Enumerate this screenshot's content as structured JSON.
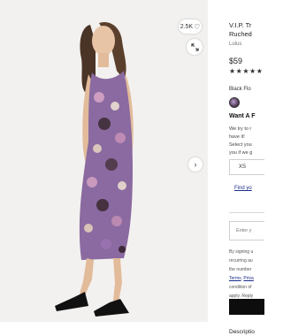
{
  "gallery": {
    "favorites_count": "2.5K",
    "heart_glyph": "♡",
    "next_glyph": "›",
    "icons": {
      "favorite": "heart-icon",
      "zoom": "expand-icon",
      "next": "chevron-right-icon"
    }
  },
  "product": {
    "title": "V.I.P. Tr\nRuched",
    "brand": "Lulus",
    "price": "$59",
    "stars": "★★★★★",
    "color_label": "Black Flo",
    "want_label": "Want A F",
    "description": "We try to r\nhave it!\nSelect you\nyou if we g",
    "size_option": "XS",
    "find_link": "Find yo"
  },
  "notify": {
    "email_placeholder": "Enter y",
    "legal_line1": "By signing u",
    "legal_line2": "recurring au",
    "legal_line3": "the number",
    "legal_terms": "Terms",
    "legal_privacy": "Priva",
    "legal_line5": "condition of",
    "legal_line6": "apply. Reply"
  },
  "description_heading": "Descriptio",
  "colors": {
    "add_button": "#0d0d0d",
    "link": "#1a2c8a",
    "image_bg": "#f3f1ef"
  }
}
